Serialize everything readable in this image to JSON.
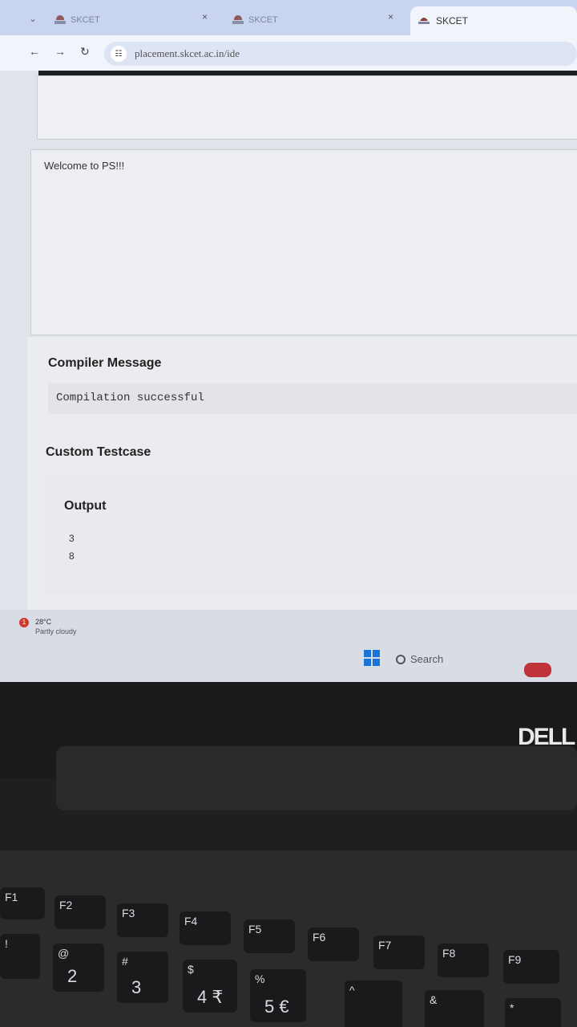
{
  "browser": {
    "tabs": [
      {
        "label": "SKCET"
      },
      {
        "label": "SKCET"
      },
      {
        "label": "SKCET"
      }
    ],
    "tab_close": "×",
    "url": "placement.skcet.ac.in/ide"
  },
  "page": {
    "welcome": "Welcome to PS!!!",
    "compiler_title": "Compiler Message",
    "compiler_message": "Compilation successful",
    "custom_testcase": "Custom Testcase",
    "output_title": "Output",
    "output_lines": [
      "3",
      "8"
    ]
  },
  "taskbar": {
    "weather_badge": "1",
    "temperature": "28°C",
    "condition": "Partly cloudy",
    "search_label": "Search"
  },
  "laptop": {
    "brand": "DELL",
    "fkeys": [
      "F1",
      "F2",
      "F3",
      "F4",
      "F5",
      "F6",
      "F7",
      "F8",
      "F9"
    ],
    "num_keys": [
      {
        "top": "!",
        "main": ""
      },
      {
        "top": "@",
        "main": "2"
      },
      {
        "top": "#",
        "main": "3"
      },
      {
        "top": "$",
        "main": "4 ₹"
      },
      {
        "top": "%",
        "main": "5 €"
      },
      {
        "top": "^",
        "main": ""
      },
      {
        "top": "&",
        "main": ""
      },
      {
        "top": "*",
        "main": ""
      }
    ]
  }
}
